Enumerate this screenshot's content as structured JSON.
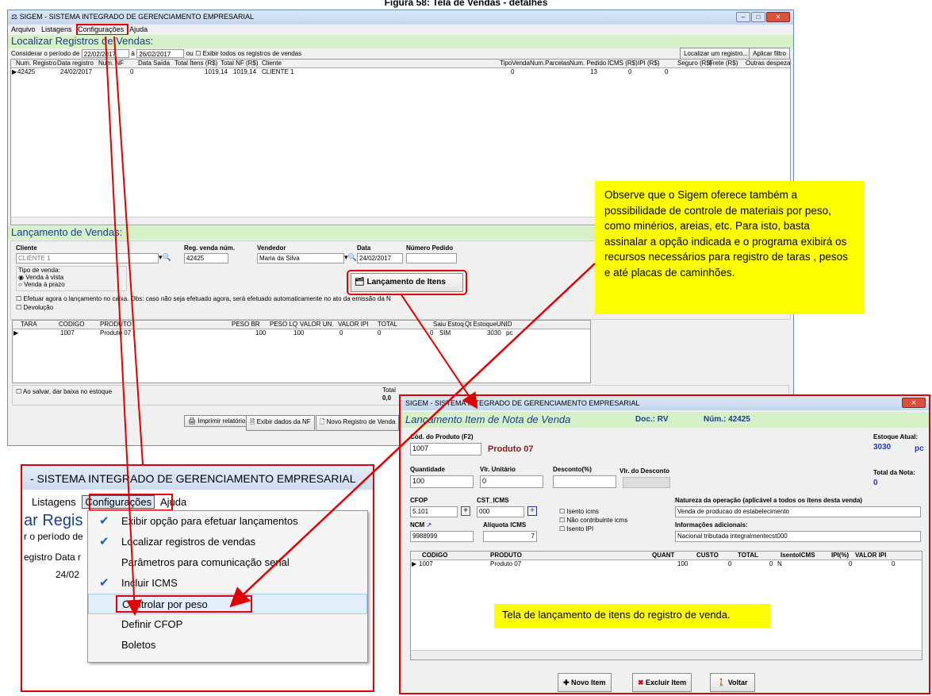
{
  "caption": "Figura 58: Tela de Vendas - detalhes",
  "main_window": {
    "title": "SIGEM - SISTEMA INTEGRADO DE GERENCIAMENTO EMPRESARIAL",
    "menu": [
      "Arquivo",
      "Listagens",
      "Configurações",
      "Ajuda"
    ],
    "section_search": "Localizar Registros de Vendas:",
    "period_label": "Considerar o período de",
    "date_from": "22/02/2017",
    "date_to_label": "à",
    "date_to": "26/02/2017",
    "or_label": "ou",
    "show_all_label": "Exibir todos os registros de vendas",
    "locate_button": "Localizar um registro...",
    "filter_button": "Aplicar filtro",
    "columns": [
      "Num. Registro",
      "Data registro",
      "Num. NF",
      "Data Saída",
      "Total Ítens (R$)",
      "Total NF (R$)",
      "Cliente",
      "TipoVenda",
      "Num.Parcelas",
      "Num. Pedido",
      "ICMS (R$)",
      "IPI (R$)",
      "Seguro (R$)",
      "Frete (R$)",
      "Outras despeza"
    ],
    "row": {
      "reg": "42425",
      "date": "24/02/2017",
      "nf": "0",
      "total_items": "1019,14",
      "total_nf": "1019,14",
      "client": "CLIENTE 1",
      "tipo": "0",
      "pedido": "13",
      "icms": "0",
      "ipi": "0"
    },
    "section_launch": "Lançamento de Vendas:",
    "client_label": "Cliente",
    "client_value": "CLIENTE 1",
    "reg_label": "Reg. venda núm.",
    "reg_value": "42425",
    "seller_label": "Vendedor",
    "seller_value": "Maria da Silva",
    "date_label": "Data",
    "date_value": "24/02/2017",
    "order_label": "Número Pedido",
    "sale_type_label": "Tipo de venda:",
    "sale_cash": "Venda à vista",
    "sale_term": "Venda à prazo",
    "launch_items_button": "Lançamento de Itens",
    "cash_note": "Efetuar agora o lançamento no caixa. Obs: caso não seja efetuado agora, será efetuado automaticamente  no ato da emissão da N",
    "devolution": "Devolução",
    "items_columns": [
      "TARA",
      "CODIGO",
      "PRODUTO",
      "PESO BR",
      "PESO LQ",
      "VALOR UN.",
      "VALOR IPI",
      "TOTAL",
      "Saiu Estoq",
      "Qt Estoque",
      "UNID"
    ],
    "item_row": {
      "code": "1007",
      "product": "Produto 07",
      "peso_br": "100",
      "peso_lq": "100",
      "valor_un": "0",
      "valor_ipi": "0",
      "total": "0",
      "saiu": "SIM",
      "qt": "3030",
      "unid": "pc"
    },
    "stock_checkbox": "Ao salvar, dar baixa no estoque",
    "total_label": "Total",
    "total_value": "0,0",
    "print_button": "Imprimir relatório",
    "show_nf_button": "Exibir dados da NF",
    "new_record_button": "Novo Registro de Venda"
  },
  "note": "Observe que o Sigem oferece também a possibilidade de controle de materiais por peso, como minérios, areias, etc. Para isto, basta assinalar a opção indicada e o programa exibirá os recursos necessários para registro de taras , pesos e até placas de caminhões.",
  "zoom": {
    "title": "- SISTEMA INTEGRADO DE GERENCIAMENTO EMPRESARIAL",
    "menu": [
      "Listagens",
      "Configurações",
      "Ajuda"
    ],
    "bg_heading": "ar Regis",
    "bg_period": "r o período de",
    "bg_cols": "egistro  Data r",
    "bg_date": "24/02",
    "items": [
      {
        "label": "Exibir opção para efetuar lançamentos",
        "checked": true
      },
      {
        "label": "Localizar registros de vendas",
        "checked": true
      },
      {
        "label": "Parâmetros para comunicação serial",
        "checked": false
      },
      {
        "label": "Incluir ICMS",
        "checked": true
      },
      {
        "label": "Controlar por peso",
        "checked": false
      },
      {
        "label": "Definir CFOP",
        "checked": false
      },
      {
        "label": "Boletos",
        "checked": false
      }
    ]
  },
  "item_window": {
    "title": "SIGEM - SISTEMA INTEGRADO DE GERENCIAMENTO EMPRESARIAL",
    "heading": "Lançamento Item de Nota de Venda",
    "doc_label": "Doc.: RV",
    "num_label": "Núm.: 42425",
    "code_label": "Cód. do Produto (F2)",
    "code_value": "1007",
    "product_name": "Produto 07",
    "stock_label": "Estoque Atual:",
    "stock_value": "3030",
    "stock_unit": "pc",
    "qty_label": "Quantidade",
    "qty_value": "100",
    "unit_price_label": "Vlr. Unitário",
    "unit_price_value": "0",
    "discount_label": "Desconto(%)",
    "discount_value_label": "Vlr. do Desconto",
    "note_total_label": "Total da Nota:",
    "note_total_value": "0",
    "cfop_label": "CFOP",
    "cfop_value": "5.101",
    "cst_label": "CST_ICMS",
    "cst_value": "000",
    "isento_icms": "Isento icms",
    "nao_contribuinte": "Não contribuinte icms",
    "isento_ipi": "Isento IPI",
    "nature_label": "Natureza da operação (aplicável a todos os ítens desta venda)",
    "nature_value": "Venda de producao do estabelecimento",
    "ncm_label": "NCM",
    "ncm_value": "9988999",
    "aliquota_label": "Alíquota ICMS",
    "aliquota_value": "7",
    "info_label": "Informações adicionais:",
    "info_value": "Nacional tributada integralmentecst000",
    "columns": [
      "CODIGO",
      "PRODUTO",
      "QUANT",
      "CUSTO",
      "TOTAL",
      "IsentoICMS",
      "IPI(%)",
      "VALOR IPI"
    ],
    "row": {
      "code": "1007",
      "product": "Produto 07",
      "quant": "100",
      "custo": "0",
      "total": "0",
      "isento": "N",
      "ipi": "0",
      "valor_ipi": "0"
    },
    "caption": "Tela de lançamento de itens do registro de venda.",
    "new_item_button": "Novo Item",
    "delete_item_button": "Excluir Item",
    "back_button": "Voltar"
  }
}
